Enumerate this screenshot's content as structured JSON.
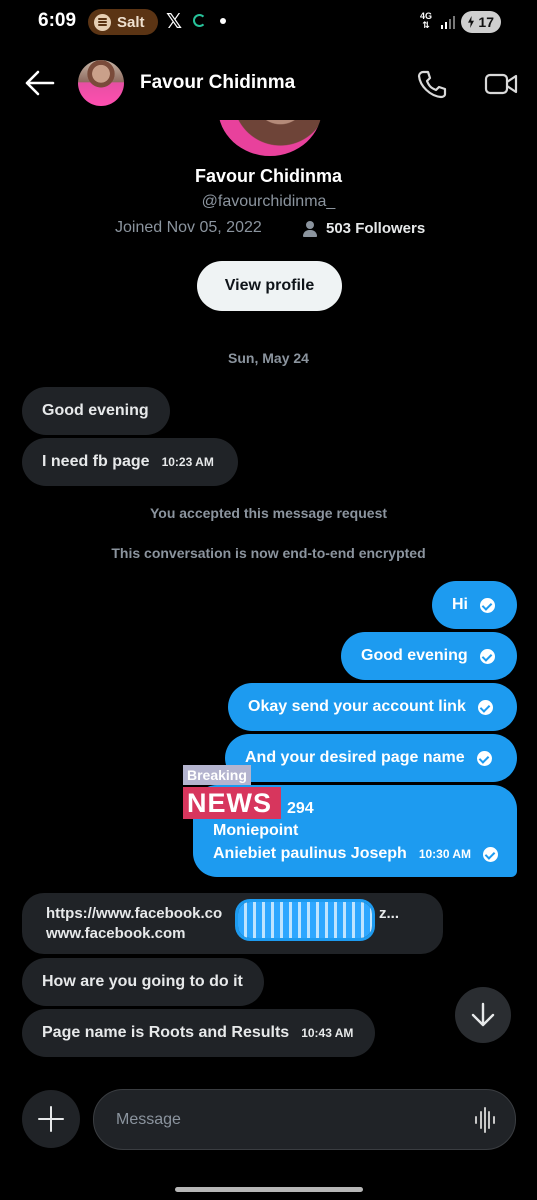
{
  "status_bar": {
    "time": "6:09",
    "spotify_label": "Salt",
    "x_label": "𝕏",
    "network": "4G",
    "battery": "17"
  },
  "header": {
    "contact_name": "Favour Chidinma"
  },
  "profile": {
    "name": "Favour Chidinma",
    "handle": "@favourchidinma_",
    "joined": "Joined Nov 05, 2022",
    "followers": "503 Followers",
    "view_profile_label": "View profile"
  },
  "conversation": {
    "date_separator": "Sun, May 24",
    "incoming_1": "Good evening",
    "incoming_2": "I need fb page",
    "incoming_2_time": "10:23 AM",
    "system_1": "You accepted this message request",
    "system_2": "This conversation is now end-to-end encrypted",
    "outgoing_1": "Hi",
    "outgoing_2": "Good evening",
    "outgoing_3": "Okay send your account link",
    "outgoing_4": "And your desired page name",
    "outgoing_5_line1": "294",
    "outgoing_5_line2": "Moniepoint",
    "outgoing_5_line3": "Aniebiet paulinus Joseph",
    "outgoing_5_time": "10:30 AM",
    "overlay_breaking": "Breaking",
    "overlay_news": "NEWS",
    "link_line1": "https://www.facebook.co",
    "link_line1_tail": "z...",
    "link_line2": "www.facebook.com",
    "incoming_3": "How are you going to do it",
    "incoming_4": "Page name is Roots and Results",
    "incoming_4_time": "10:43 AM"
  },
  "composer": {
    "placeholder": "Message"
  },
  "colors": {
    "accent": "#1d9bf0",
    "incoming_bubble": "#202327",
    "background": "#000000"
  }
}
